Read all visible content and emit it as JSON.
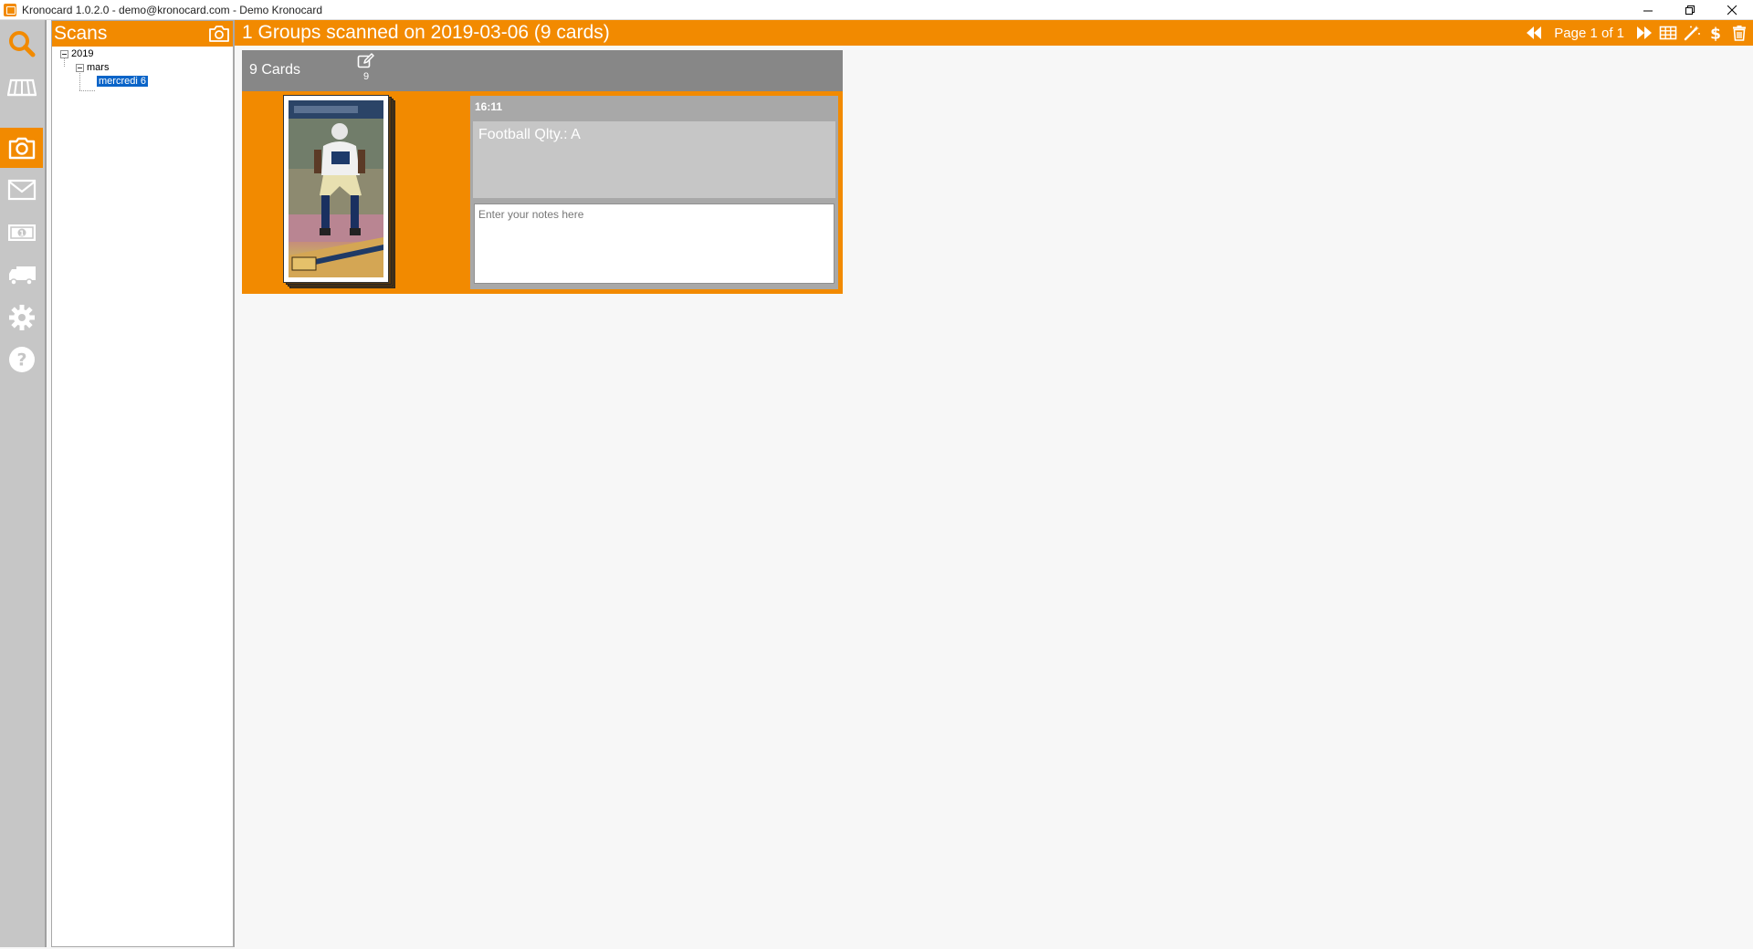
{
  "window": {
    "title": "Kronocard 1.0.2.0 - demo@kronocard.com - Demo Kronocard"
  },
  "rail": {
    "items": [
      {
        "name": "search",
        "icon": "search-icon",
        "active": false
      },
      {
        "name": "inventory",
        "icon": "shelf-icon",
        "active": false
      },
      {
        "name": "scans",
        "icon": "camera-icon",
        "active": true
      },
      {
        "name": "messages",
        "icon": "envelope-icon",
        "active": false
      },
      {
        "name": "sales",
        "icon": "money-icon",
        "active": false
      },
      {
        "name": "shipping",
        "icon": "truck-icon",
        "active": false
      },
      {
        "name": "settings",
        "icon": "gear-icon",
        "active": false
      },
      {
        "name": "help",
        "icon": "help-icon",
        "active": false
      }
    ]
  },
  "scans": {
    "title": "Scans",
    "tree": {
      "year": "2019",
      "month": "mars",
      "day": "mercredi 6"
    }
  },
  "main": {
    "title": "1 Groups scanned on 2019-03-06 (9 cards)",
    "page_label": "Page 1 of 1"
  },
  "group": {
    "count_label": "9 Cards",
    "edit_count": "9",
    "time": "16:11",
    "description": "Football Qlty.: A",
    "notes_placeholder": "Enter your notes here"
  },
  "colors": {
    "accent": "#f28a00",
    "rail": "#c6c6c6",
    "group_header": "#878787",
    "selection": "#0a64c8"
  }
}
